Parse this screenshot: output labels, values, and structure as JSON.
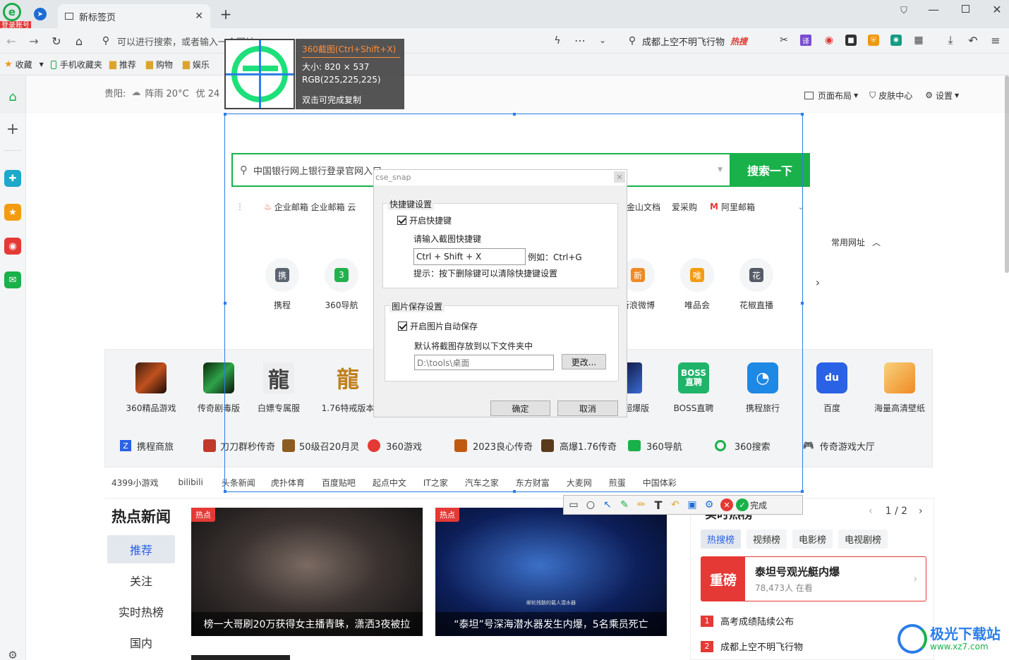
{
  "browser": {
    "login_badge": "登录账号",
    "tab_title": "新标签页",
    "address_placeholder": "可以进行搜索，或者输入一个网址",
    "hot_search": "成都上空不明飞行物",
    "hot_badge": "热搜",
    "bookmarks": [
      "收藏",
      "手机收藏夹",
      "推荐",
      "购物",
      "娱乐"
    ]
  },
  "page": {
    "weather": {
      "city": "贵阳:",
      "condition": "阵雨 20°C",
      "aqi": "优 24"
    },
    "top_right": {
      "layout": "页面布局",
      "skin": "皮肤中心",
      "settings": "设置"
    },
    "search": {
      "query": "中国银行网上银行登录官网入口",
      "button": "搜索一下"
    },
    "quick_links": [
      "企业邮箱 企业邮箱 云",
      "金山文档",
      "爱采购",
      "阿里邮箱"
    ],
    "common_sites_label": "常用网址",
    "shortcut_left": [
      {
        "icon": "携",
        "label": "携程",
        "color": "#5b6470"
      },
      {
        "icon": "3",
        "label": "360导航",
        "color": "#22b14c"
      }
    ],
    "shortcut_right": [
      {
        "icon": "新",
        "label": "新浪微博",
        "color": "#f08a24"
      },
      {
        "icon": "唯",
        "label": "唯品会",
        "color": "#f39c12"
      },
      {
        "icon": "花",
        "label": "花椒直播",
        "color": "#555b66"
      }
    ],
    "games_left": [
      "360精品游戏",
      "传奇剧毒版",
      "白嫖专属服",
      "1.76特戒版本"
    ],
    "games_right": [
      "超爆版",
      "BOSS直聘",
      "携程旅行",
      "百度",
      "海量高清壁纸"
    ],
    "game_links": [
      "携程商旅",
      "刀刀群秒传奇",
      "50级召20月灵",
      "360游戏",
      "2023良心传奇",
      "高爆1.76传奇",
      "360导航",
      "360搜索",
      "传奇游戏大厅"
    ],
    "text_links": [
      "4399小游戏",
      "bilibili",
      "头条新闻",
      "虎扑体育",
      "百度贴吧",
      "起点中文",
      "IT之家",
      "汽车之家",
      "东方财富",
      "大麦网",
      "煎蛋",
      "中国体彩"
    ],
    "news": {
      "title": "热点新闻",
      "tabs": [
        "推荐",
        "关注",
        "实时热榜",
        "国内"
      ],
      "badge": "热点",
      "card1": "榜一大哥刷20万获得女主播青睐，潇洒3夜被拉",
      "card2": "“泰坦”号深海潜水器发生内爆，5名乘员死亡",
      "card2_caption": "邮轮残骸的载人潜水器"
    },
    "hot_panel": {
      "title": "实时热榜",
      "pager": "1 / 2",
      "tabs": [
        "热搜榜",
        "视频榜",
        "电影榜",
        "电视剧榜"
      ],
      "featured_tag": "重磅",
      "featured_title": "泰坦号观光艇内爆",
      "featured_meta": "78,473人 在看",
      "items": [
        {
          "rank": "1",
          "text": "高考成绩陆续公布"
        },
        {
          "rank": "2",
          "text": "成都上空不明飞行物"
        }
      ]
    },
    "watermark": {
      "name": "极光下载站",
      "url": "www.xz7.com"
    }
  },
  "capture": {
    "title": "360截图(Ctrl+Shift+X)",
    "size": "大小: 820 × 537",
    "rgb": "RGB(225,225,225)",
    "hint": "双击可完成复制"
  },
  "dialog": {
    "title": "cse_snap",
    "hotkey_group": "快捷键设置",
    "enable_hotkey": "开启快捷键",
    "enter_hotkey": "请输入截图快捷键",
    "hotkey_value": "Ctrl + Shift + X",
    "example": "例如：Ctrl+G",
    "tip": "提示：按下删除键可以清除快捷键设置",
    "save_group": "图片保存设置",
    "enable_autosave": "开启图片自动保存",
    "save_desc": "默认将截图存放到以下文件夹中",
    "folder": "D:\\tools\\桌面",
    "change": "更改...",
    "ok": "确定",
    "cancel": "取消"
  },
  "toolbar": {
    "done": "完成"
  }
}
